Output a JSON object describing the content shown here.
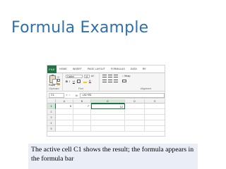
{
  "slide": {
    "title": "Formula Example",
    "caption": "The active cell C1 shows the result; the formula appears in the formula bar"
  },
  "excel": {
    "tabs": [
      "FILE",
      "HOME",
      "INSERT",
      "PAGE LAYOUT",
      "FORMULAS",
      "DATA",
      "RE"
    ],
    "ribbon": {
      "paste_label": "Paste",
      "clipboard_label": "Clipboard",
      "font_label": "Font",
      "alignment_label": "Alignment",
      "font_name": "Calibri",
      "font_size": "11",
      "wrap_label": "Wrap"
    },
    "name_box": "C1",
    "formula": "=A1+B1",
    "columns": [
      "A",
      "B",
      "C",
      "D",
      "E"
    ],
    "rows": [
      "1",
      "2",
      "3",
      "4",
      "5"
    ],
    "cells": {
      "A1": "5",
      "B1": "7",
      "C1": "12"
    },
    "colors": {
      "accent": "#217346",
      "title": "#2f6fa8",
      "caption_bg": "#e9eef7"
    }
  }
}
